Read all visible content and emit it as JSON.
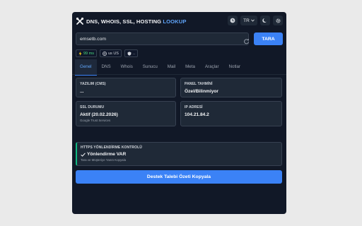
{
  "header": {
    "logo_icon": "tools-icon",
    "title_main": "DNS, WHOIS, SSL, HOSTING ",
    "title_accent": "LOOKUP",
    "lang": "TR",
    "accent_color": "#60a5fa"
  },
  "search": {
    "value": "emsetb.com",
    "button_label": "TARA"
  },
  "chips": {
    "speed": "99 ms",
    "country": "us US",
    "extra": ".."
  },
  "tabs": [
    "Genel",
    "DNS",
    "Whois",
    "Sunucu",
    "Mail",
    "Meta",
    "Araçlar",
    "Notlar"
  ],
  "active_tab": 0,
  "cards": {
    "software": {
      "label": "YAZILIM (CMS)",
      "value": "..."
    },
    "panel": {
      "label": "PANEL TAHMİNİ",
      "value": "Özel/Bilinmiyor"
    },
    "ssl": {
      "label": "SSL DURUMU",
      "value": "Aktif (20.02.2026)",
      "sub": "Google Trust Services"
    },
    "ip": {
      "label": "IP ADRESİ",
      "value": "104.21.84.2"
    }
  },
  "redirect": {
    "label": "HTTPS YÖNLENDİRME KONTROLÜ",
    "status": "Yönlendirme VAR",
    "sub": "Tara ve Müşteriye Yanıtı Kopyala",
    "accent_color": "#10b981"
  },
  "copy_button": "Destek Talebi Özeti Kopyala"
}
